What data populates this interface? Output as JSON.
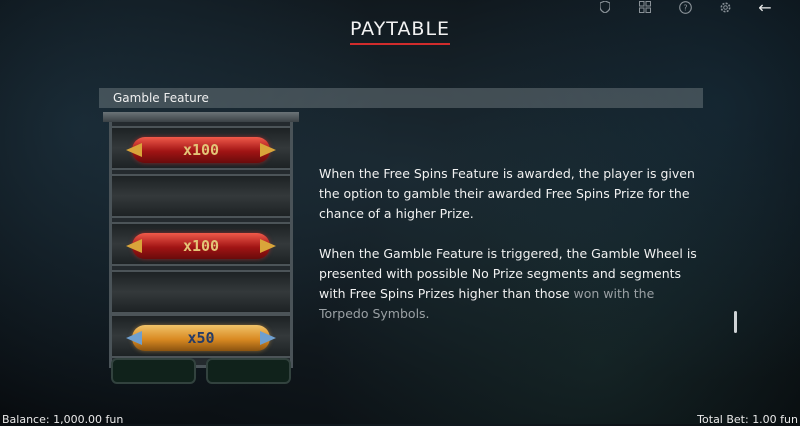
{
  "title": "PAYTABLE",
  "topbar": {
    "icons": [
      "shield-icon",
      "grid-icon",
      "help-icon",
      "settings-icon",
      "back-arrow-icon"
    ],
    "back_glyph": "←"
  },
  "section": {
    "label": "Gamble Feature"
  },
  "reel": {
    "symbols": [
      {
        "type": "torpedo-red",
        "label": "x100"
      },
      {
        "type": "empty",
        "label": ""
      },
      {
        "type": "torpedo-red",
        "label": "x100"
      },
      {
        "type": "empty",
        "label": ""
      },
      {
        "type": "torpedo-gold",
        "label": "x50"
      }
    ]
  },
  "description": {
    "paragraph1": "When the Free Spins Feature is awarded, the player is given the option to gamble their awarded Free Spins Prize for the chance of a higher Prize.",
    "paragraph2_main": "When the Gamble Feature is triggered, the Gamble Wheel is presented with possible No Prize segments and segments with Free Spins Prizes higher than those",
    "paragraph2_faded": "won with the Torpedo Symbols."
  },
  "footer": {
    "balance": "Balance: 1,000.00 fun",
    "total_bet": "Total Bet: 1.00 fun"
  }
}
